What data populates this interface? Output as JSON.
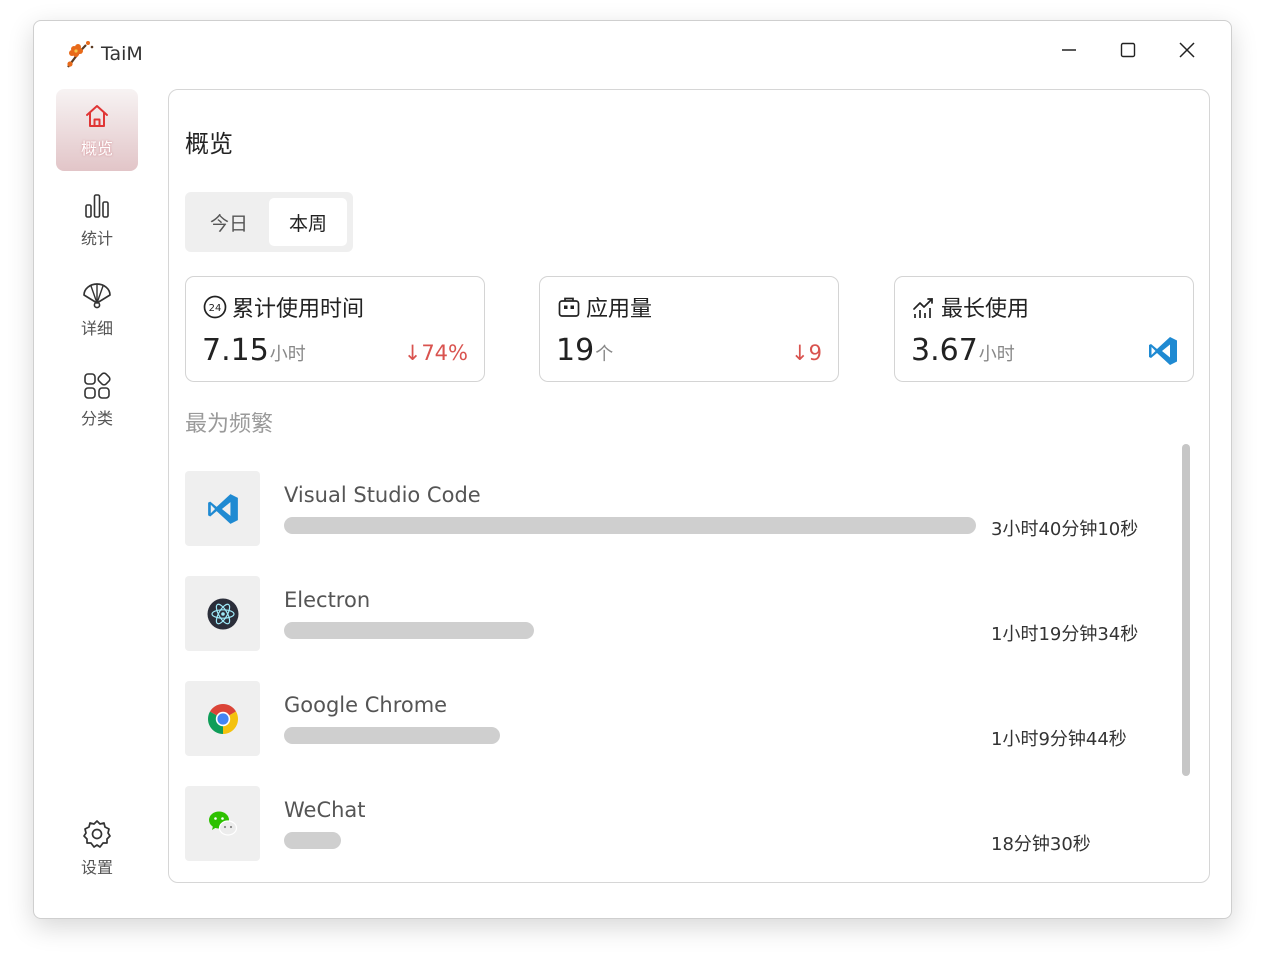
{
  "app": {
    "name": "TaiM"
  },
  "nav": {
    "items": [
      {
        "label": "概览",
        "icon": "home-icon",
        "active": true
      },
      {
        "label": "统计",
        "icon": "bar-chart-icon",
        "active": false
      },
      {
        "label": "详细",
        "icon": "fan-icon",
        "active": false
      },
      {
        "label": "分类",
        "icon": "category-icon",
        "active": false
      }
    ],
    "settings": {
      "label": "设置",
      "icon": "gear-icon"
    }
  },
  "page": {
    "title": "概览",
    "tabs": [
      {
        "label": "今日",
        "selected": false
      },
      {
        "label": "本周",
        "selected": true
      }
    ]
  },
  "cards": [
    {
      "title": "累计使用时间",
      "icon": "clock-24-icon",
      "value": "7.15",
      "unit": "小时",
      "delta": "↓74%"
    },
    {
      "title": "应用量",
      "icon": "app-box-icon",
      "value": "19",
      "unit": "个",
      "delta": "↓9"
    },
    {
      "title": "最长使用",
      "icon": "trend-icon",
      "value": "3.67",
      "unit": "小时",
      "app_icon": "vscode-icon"
    }
  ],
  "frequent": {
    "title": "最为频繁",
    "apps": [
      {
        "name": "Visual Studio Code",
        "time": "3小时40分钟10秒",
        "icon": "vscode-icon",
        "share": 1.0
      },
      {
        "name": "Electron",
        "time": "1小时19分钟34秒",
        "icon": "electron-icon",
        "share": 0.361
      },
      {
        "name": "Google Chrome",
        "time": "1小时9分钟44秒",
        "icon": "chrome-icon",
        "share": 0.312
      },
      {
        "name": "WeChat",
        "time": "18分钟30秒",
        "icon": "wechat-icon",
        "share": 0.082
      }
    ]
  },
  "colors": {
    "accent": "#e03535",
    "delta_down": "#d9534f",
    "bar": "#cfcfcf",
    "vscode": "#1f8ad2"
  }
}
